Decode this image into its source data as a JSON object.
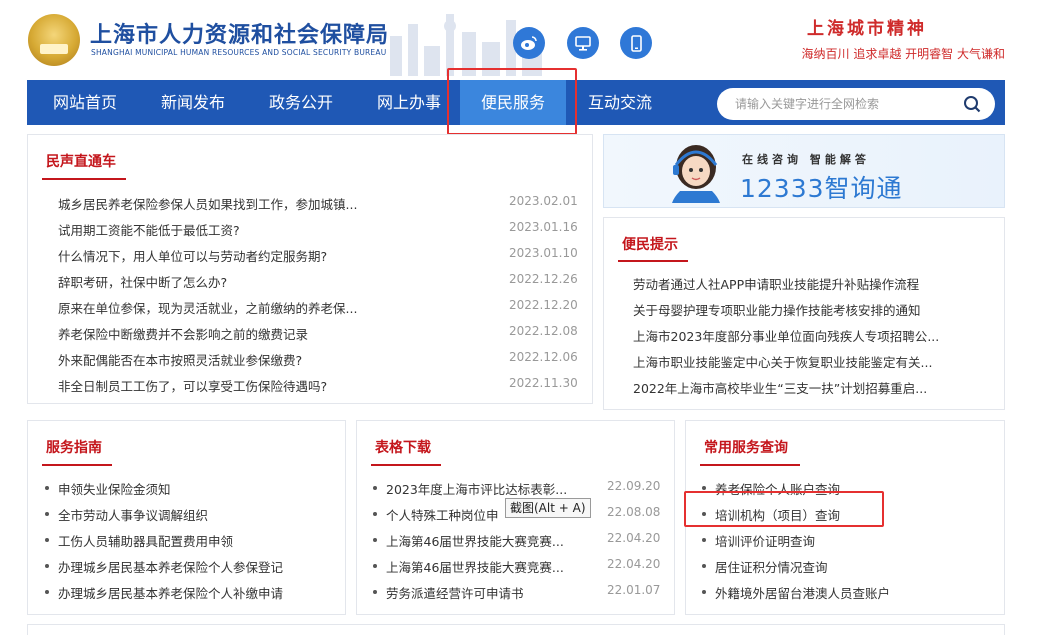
{
  "header": {
    "title": "上海市人力资源和社会保障局",
    "subtitle": "SHANGHAI MUNICIPAL HUMAN RESOURCES AND SOCIAL SECURITY BUREAU",
    "icons": [
      "weibo-icon",
      "desktop-icon",
      "mobile-icon"
    ],
    "spirit_title": "上海城市精神",
    "spirit_words": "海纳百川  追求卓越  开明睿智  大气谦和"
  },
  "nav": {
    "items": [
      "网站首页",
      "新闻发布",
      "政务公开",
      "网上办事",
      "便民服务",
      "互动交流"
    ],
    "active": "便民服务",
    "search_placeholder": "请输入关键字进行全网检索"
  },
  "qa": {
    "title": "民声直通车",
    "items": [
      {
        "text": "城乡居民养老保险参保人员如果找到工作，参加城镇...",
        "date": "2023.02.01"
      },
      {
        "text": "试用期工资能不能低于最低工资?",
        "date": "2023.01.16"
      },
      {
        "text": "什么情况下，用人单位可以与劳动者约定服务期?",
        "date": "2023.01.10"
      },
      {
        "text": "辞职考研，社保中断了怎么办?",
        "date": "2022.12.26"
      },
      {
        "text": "原来在单位参保，现为灵活就业，之前缴纳的养老保...",
        "date": "2022.12.20"
      },
      {
        "text": "养老保险中断缴费并不会影响之前的缴费记录",
        "date": "2022.12.08"
      },
      {
        "text": "外来配偶能否在本市按照灵活就业参保缴费?",
        "date": "2022.12.06"
      },
      {
        "text": "非全日制员工工伤了，可以享受工伤保险待遇吗?",
        "date": "2022.11.30"
      }
    ]
  },
  "banner": {
    "top": "在线咨询  智能解答",
    "main": "12333智询通"
  },
  "tips": {
    "title": "便民提示",
    "items": [
      "劳动者通过人社APP申请职业技能提升补贴操作流程",
      "关于母婴护理专项职业能力操作技能考核安排的通知",
      "上海市2023年度部分事业单位面向残疾人专项招聘公...",
      "上海市职业技能鉴定中心关于恢复职业技能鉴定有关...",
      "2022年上海市高校毕业生“三支一扶”计划招募重启..."
    ]
  },
  "guide": {
    "title": "服务指南",
    "items": [
      "申领失业保险金须知",
      "全市劳动人事争议调解组织",
      "工伤人员辅助器具配置费用申领",
      "办理城乡居民基本养老保险个人参保登记",
      "办理城乡居民基本养老保险个人补缴申请"
    ]
  },
  "forms": {
    "title": "表格下载",
    "items": [
      {
        "text": "2023年度上海市评比达标表彰...",
        "date": "22.09.20"
      },
      {
        "text": "个人特殊工种岗位申",
        "date": "22.08.08"
      },
      {
        "text": "上海第46届世界技能大赛竞赛...",
        "date": "22.04.20"
      },
      {
        "text": "上海第46届世界技能大赛竞赛...",
        "date": "22.04.20"
      },
      {
        "text": "劳务派遣经营许可申请书",
        "date": "22.01.07"
      }
    ]
  },
  "query": {
    "title": "常用服务查询",
    "items": [
      "养老保险个人账户查询",
      "培训机构（项目）查询",
      "培训评价证明查询",
      "居住证积分情况查询",
      "外籍境外居留台港澳人员查账户"
    ]
  },
  "tooltip": "截图(Alt + A)",
  "colors": {
    "nav": "#1f58b5",
    "nav_active": "#3b86dd",
    "accent_red": "#c4161c",
    "highlight_box": "#e53030"
  }
}
